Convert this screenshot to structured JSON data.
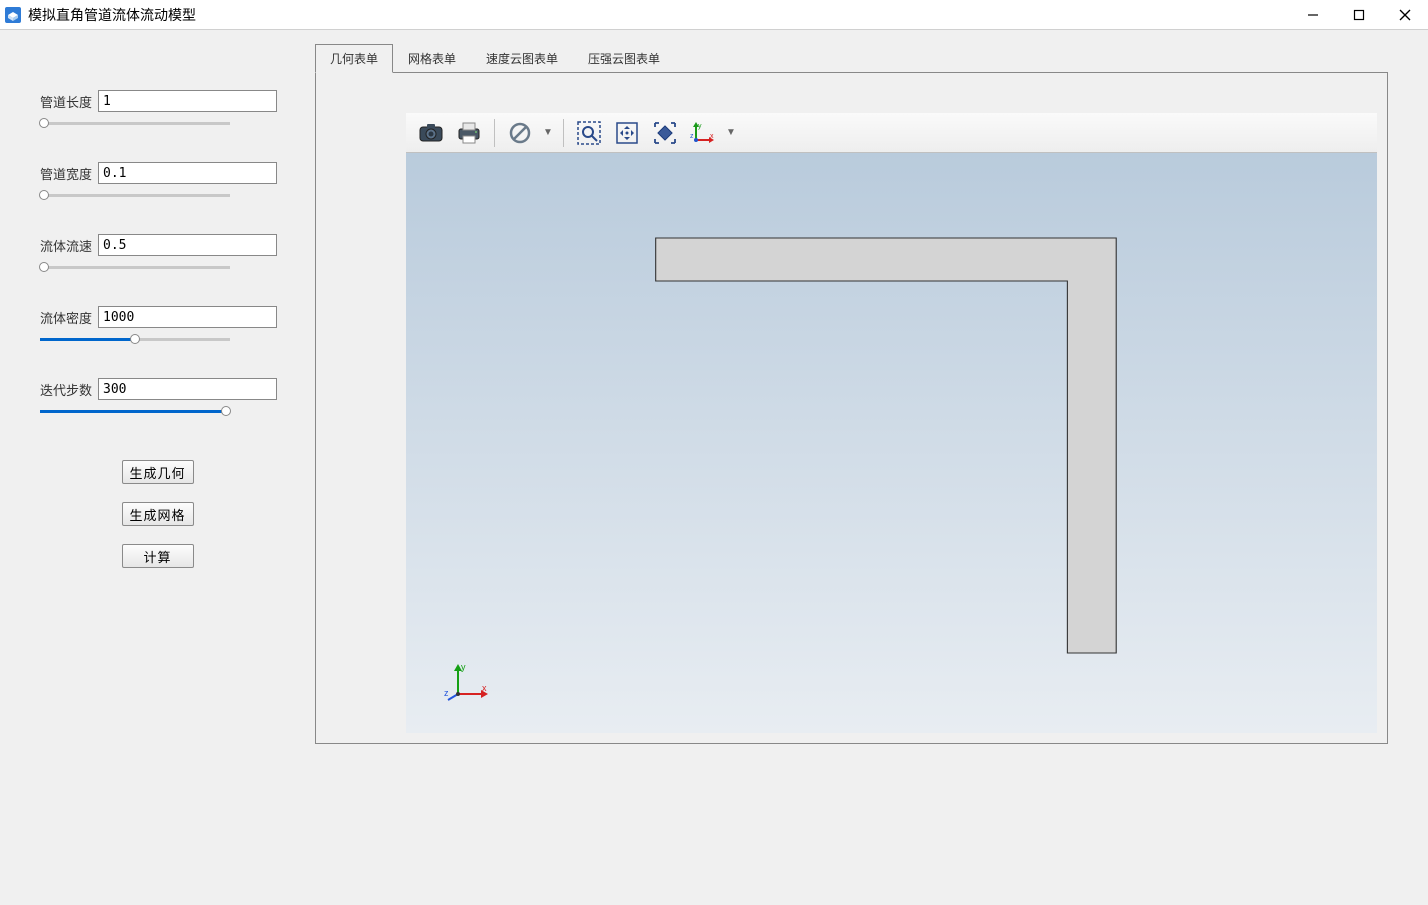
{
  "app": {
    "title": "模拟直角管道流体流动模型"
  },
  "sidebar": {
    "params": [
      {
        "label": "管道长度",
        "value": "1",
        "slider_pct": 2
      },
      {
        "label": "管道宽度",
        "value": "0.1",
        "slider_pct": 2
      },
      {
        "label": "流体流速",
        "value": "0.5",
        "slider_pct": 2
      },
      {
        "label": "流体密度",
        "value": "1000",
        "slider_pct": 50
      },
      {
        "label": "迭代步数",
        "value": "300",
        "slider_pct": 98
      }
    ],
    "buttons": {
      "generate_geometry": "生成几何",
      "generate_mesh": "生成网格",
      "compute": "计算"
    }
  },
  "tabs": [
    {
      "label": "几何表单",
      "active": true
    },
    {
      "label": "网格表单",
      "active": false
    },
    {
      "label": "速度云图表单",
      "active": false
    },
    {
      "label": "压强云图表单",
      "active": false
    }
  ],
  "toolbar_icons": [
    "camera-icon",
    "printer-icon",
    "sep",
    "disable-icon",
    "dropdown-icon",
    "sep",
    "zoom-area-icon",
    "pan-icon",
    "fit-view-icon",
    "axis-icon",
    "dropdown-icon"
  ],
  "canvas": {
    "axis_labels": {
      "x": "x",
      "y": "y",
      "z": "z"
    }
  }
}
